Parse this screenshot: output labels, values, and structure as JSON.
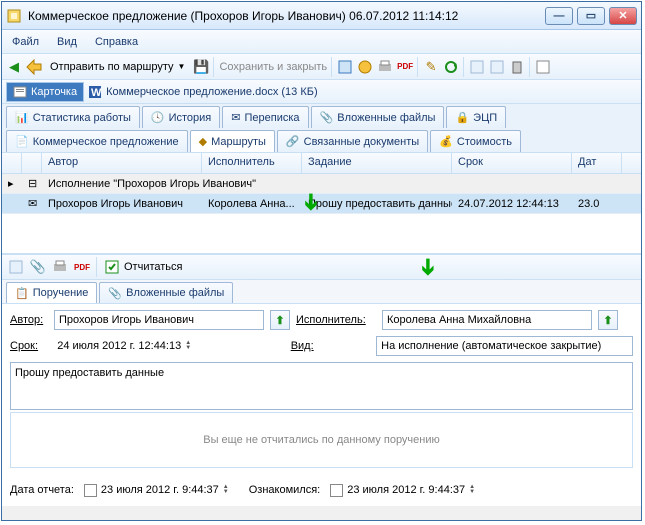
{
  "window": {
    "title": "Коммерческое предложение (Прохоров Игорь Иванович) 06.07.2012 11:14:12"
  },
  "menu": {
    "file": "Файл",
    "view": "Вид",
    "help": "Справка"
  },
  "toolbar": {
    "send": "Отправить по маршруту",
    "saveclose": "Сохранить и закрыть"
  },
  "tabs_doc": {
    "card": "Карточка",
    "embed": "Коммерческое предложение.docx (13 КБ)"
  },
  "tabs1": [
    "Статистика работы",
    "История",
    "Переписка",
    "Вложенные файлы",
    "ЭЦП"
  ],
  "tabs2": [
    "Коммерческое предложение",
    "Маршруты",
    "Связанные документы",
    "Стоимость"
  ],
  "grid": {
    "headers": [
      "",
      "",
      "Автор",
      "Исполнитель",
      "Задание",
      "Срок",
      "Дат"
    ],
    "rows": [
      {
        "icon": "⊟",
        "col2": "Исполнение \"Прохоров Игорь Иванович\"",
        "span": true
      },
      {
        "icon": "✉",
        "author": "Прохоров Игорь Иванович",
        "executor": "Королева Анна...",
        "task": "Прошу предоставить данные",
        "due": "24.07.2012 12:44:13",
        "dat": "23.0",
        "selected": true
      }
    ]
  },
  "lowtool": {
    "report": "Отчитаться"
  },
  "tabs3": [
    "Поручение",
    "Вложенные файлы"
  ],
  "form": {
    "author_label": "Автор:",
    "author_value": "Прохоров Игорь Иванович",
    "executor_label": "Исполнитель:",
    "executor_value": "Королева Анна Михайловна",
    "due_label": "Срок:",
    "due_value": "24    июля    2012 г. 12:44:13",
    "kind_label": "Вид:",
    "kind_value": "На исполнение (автоматическое закрытие)",
    "task_text": "Прошу предоставить данные"
  },
  "notice": "Вы еще не отчитались по данному поручению",
  "bottom": {
    "report_date_label": "Дата отчета:",
    "report_date_value": "23    июля    2012 г.  9:44:37",
    "ack_label": "Ознакомился:",
    "ack_value": "23    июля    2012 г.  9:44:37"
  }
}
